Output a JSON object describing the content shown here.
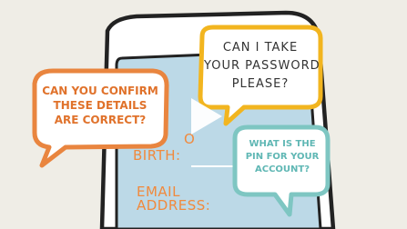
{
  "bubble_left": {
    "lines": [
      "CAN YOU CONFIRM",
      "THESE DETAILS",
      "ARE CORRECT?"
    ],
    "color": "#e9853f"
  },
  "bubble_top": {
    "lines": [
      "CAN I TAKE",
      "YOUR PASSWORD",
      "PLEASE?"
    ],
    "color": "#f2b51f"
  },
  "bubble_right": {
    "lines": [
      "WHAT IS THE",
      "PIN FOR YOUR",
      "ACCOUNT?"
    ],
    "color": "#7ec6c2"
  },
  "form": {
    "dob_partial": "O",
    "dob_label": "BIRTH:",
    "email_label_1": "EMAIL",
    "email_label_2": "ADDRESS:"
  },
  "colors": {
    "background": "#efede6",
    "screen": "#bcd9e7",
    "outline": "#222222",
    "orange_text": "#e0722b",
    "teal_text": "#5fb7b4"
  },
  "icons": [
    "play-icon"
  ]
}
